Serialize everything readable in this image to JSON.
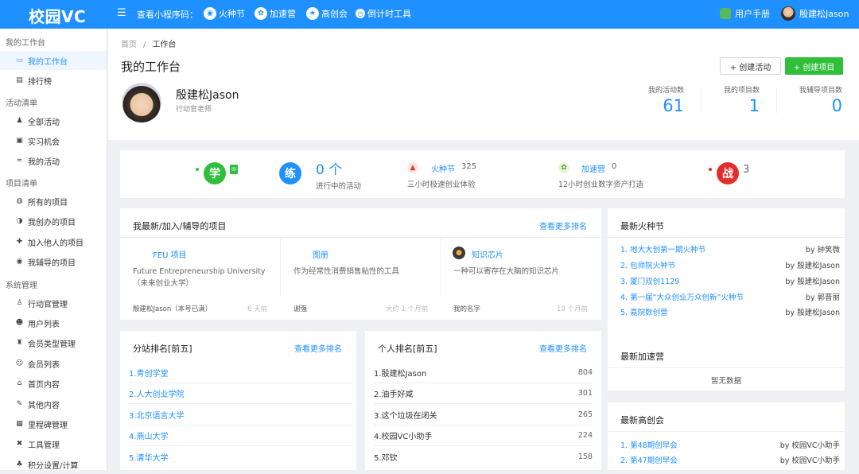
{
  "topbar": {
    "logo": "校园VC",
    "program_label": "查看小程序码：",
    "nav": [
      {
        "label": "火种节",
        "icon": "fire-badge-icon"
      },
      {
        "label": "加速营",
        "icon": "gear-badge-icon"
      },
      {
        "label": "高创会",
        "icon": "star-badge-icon"
      },
      {
        "label": "倒计时工具",
        "icon": "clock-icon"
      }
    ],
    "manual": "用户手册",
    "user": "殷建松Jason"
  },
  "sidebar": {
    "groups": [
      {
        "title": "我的工作台",
        "items": [
          {
            "label": "我的工作台",
            "icon": "monitor-icon",
            "active": true
          },
          {
            "label": "排行榜",
            "icon": "ranking-icon"
          }
        ]
      },
      {
        "title": "活动清单",
        "items": [
          {
            "label": "全部活动",
            "icon": "activity-icon"
          },
          {
            "label": "实习机会",
            "icon": "internship-icon"
          },
          {
            "label": "我的活动",
            "icon": "my-activity-icon"
          }
        ]
      },
      {
        "title": "项目清单",
        "items": [
          {
            "label": "所有的项目",
            "icon": "globe-icon"
          },
          {
            "label": "我创办的项目",
            "icon": "founder-icon"
          },
          {
            "label": "加入他人的项目",
            "icon": "join-icon"
          },
          {
            "label": "我辅导的项目",
            "icon": "eye-icon"
          }
        ]
      },
      {
        "title": "系统管理",
        "items": [
          {
            "label": "行动官管理",
            "icon": "officer-icon"
          },
          {
            "label": "用户列表",
            "icon": "users-icon"
          },
          {
            "label": "会员类型管理",
            "icon": "member-type-icon"
          },
          {
            "label": "会员列表",
            "icon": "member-list-icon"
          },
          {
            "label": "首页内容",
            "icon": "home-icon"
          },
          {
            "label": "其他内容",
            "icon": "edit-icon"
          },
          {
            "label": "里程碑管理",
            "icon": "milestone-icon"
          },
          {
            "label": "工具管理",
            "icon": "tools-icon"
          },
          {
            "label": "积分设置/计算",
            "icon": "points-icon"
          }
        ]
      }
    ]
  },
  "header": {
    "breadcrumb_home": "首页",
    "breadcrumb_sep": "/",
    "breadcrumb_current": "工作台",
    "title": "我的工作台",
    "btn_create_activity": "+ 创建活动",
    "btn_create_project": "+ 创建项目",
    "user_name": "殷建松Jason",
    "user_role": "行动官老师",
    "stats": [
      {
        "label": "我的活动数",
        "value": "61"
      },
      {
        "label": "我的项目数",
        "value": "1"
      },
      {
        "label": "我辅导项目数",
        "value": "0"
      }
    ]
  },
  "band": {
    "learn": "学",
    "practice": "练",
    "ongoing_count": "0 个",
    "ongoing_label": "进行中的活动",
    "spark_name": "火种节",
    "spark_count": "325",
    "spark_desc": "三小时极速创业体验",
    "accel_name": "加速营",
    "accel_count": "0",
    "accel_desc": "12小时创业数字资产打造",
    "battle": "战",
    "battle_count": "3"
  },
  "projects": {
    "title": "我最新/加入/辅导的项目",
    "more": "查看更多排名",
    "items": [
      {
        "name": "FEU 项目",
        "desc": "Future Entrepreneurship University（未来创业大学）",
        "meta": "殷建松Jason（本号已满）",
        "time": "6 天前"
      },
      {
        "name": "图册",
        "desc": "作为经常性消费销售粘性的工具",
        "meta": "谢强",
        "time": "大约 1 个月前"
      },
      {
        "name": "知识芯片",
        "desc": "一种可以寄存在大脑的知识芯片",
        "meta": "我的名字",
        "time": "10 个月前"
      }
    ]
  },
  "branch_rank": {
    "title": "分站排名[前五]",
    "more": "查看更多排名",
    "items": [
      "1.青创学堂",
      "2.人大创业学院",
      "3.北京语言大学",
      "4.燕山大学",
      "5.清华大学"
    ]
  },
  "personal_rank": {
    "title": "个人排名[前五]",
    "more": "查看更多排名",
    "items": [
      {
        "name": "1.殷建松Jason",
        "score": "804"
      },
      {
        "name": "2.油手好咸",
        "score": "301"
      },
      {
        "name": "3.这个垃圾在闭关",
        "score": "265"
      },
      {
        "name": "4.校园VC小助手",
        "score": "224"
      },
      {
        "name": "5.邓钦",
        "score": "158"
      }
    ]
  },
  "latest_spark": {
    "title": "最新火种节",
    "items": [
      {
        "name": "1. 地大大创第一期火种节",
        "author": "by 钟笑微"
      },
      {
        "name": "2. 包师院火种节",
        "author": "by 殷建松Jason"
      },
      {
        "name": "3. 厦门双创1129",
        "author": "by 殷建松Jason"
      },
      {
        "name": "4. 第一届“大众创业万众创新”火种节",
        "author": "by 郭晋丽"
      },
      {
        "name": "5. 嘉院数创营",
        "author": "by 殷建松Jason"
      }
    ]
  },
  "latest_accel": {
    "title": "最新加速营",
    "empty": "暂无数据"
  },
  "latest_summit": {
    "title": "最新高创会",
    "items": [
      {
        "name": "1. 第48期创早会",
        "author": "by 校园VC小助手"
      },
      {
        "name": "2. 第47期创早会",
        "author": "by 校园VC小助手"
      }
    ]
  }
}
